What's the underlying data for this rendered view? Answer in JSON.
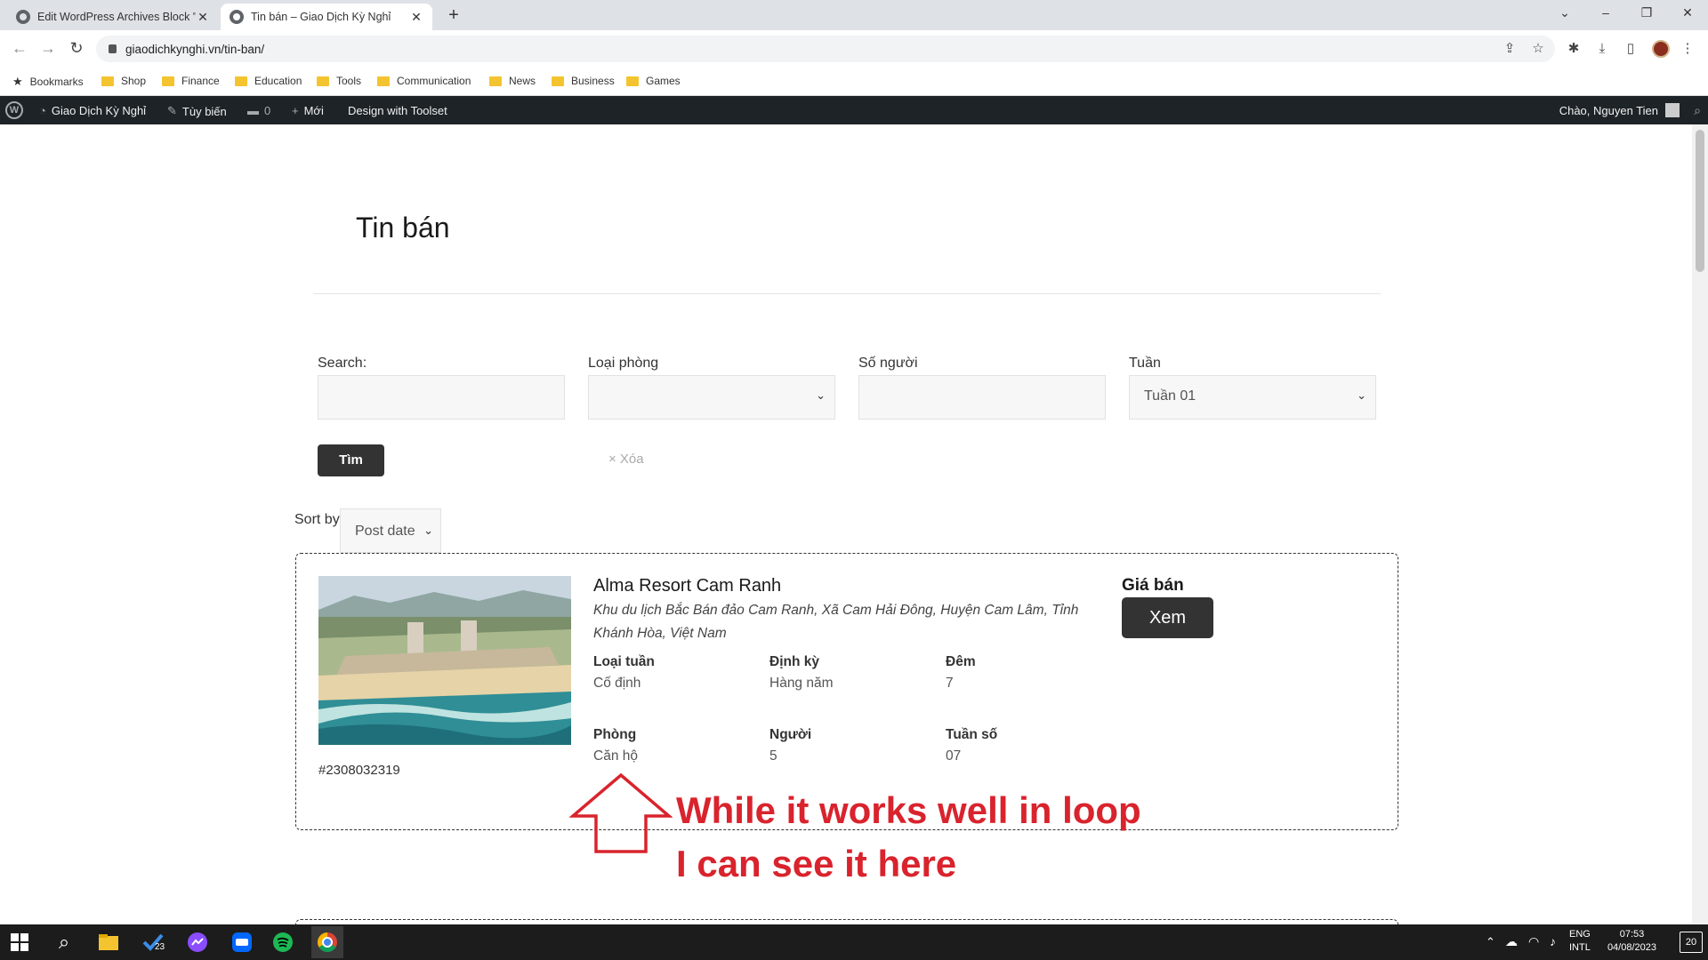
{
  "browser": {
    "tabs": [
      {
        "title": "Edit WordPress Archives Block \"T",
        "active": false
      },
      {
        "title": "Tin bán – Giao Dịch Kỳ Nghỉ",
        "active": true
      }
    ],
    "url": "giaodichkynghi.vn/tin-ban/",
    "bookmarks": [
      "Bookmarks",
      "Shop",
      "Finance",
      "Education",
      "Tools",
      "Communication",
      "News",
      "Business",
      "Games"
    ]
  },
  "admin_bar": {
    "site_name": "Giao Dịch Kỳ Nghỉ",
    "customize": "Tùy biến",
    "comments_count": "0",
    "new_label": "Mới",
    "toolset": "Design with Toolset",
    "greeting": "Chào, Nguyen Tien"
  },
  "page": {
    "title": "Tin bán"
  },
  "filters": {
    "search_label": "Search:",
    "search_value": "",
    "room_type_label": "Loại phòng",
    "room_type_value": "",
    "persons_label": "Số người",
    "persons_value": "",
    "week_label": "Tuần",
    "week_value": "Tuần 01",
    "submit_label": "Tìm",
    "reset_label": "× Xóa",
    "sort_label": "Sort by",
    "sort_value": "Post date"
  },
  "listing": {
    "name": "Alma Resort Cam Ranh",
    "address": "Khu du lịch Bắc Bán đảo Cam Ranh, Xã Cam Hải Đông, Huyện Cam Lâm, Tỉnh Khánh Hòa, Việt Nam",
    "ref": "#2308032319",
    "fields": [
      {
        "label": "Loại tuần",
        "value": "Cố định"
      },
      {
        "label": "Định kỳ",
        "value": "Hàng năm"
      },
      {
        "label": "Đêm",
        "value": "7"
      },
      {
        "label": "Phòng",
        "value": "Căn hộ"
      },
      {
        "label": "Người",
        "value": "5"
      },
      {
        "label": "Tuần số",
        "value": "07"
      }
    ],
    "price_label": "Giá bán",
    "view_button": "Xem"
  },
  "annotation": {
    "line1": "While it works well in loop",
    "line2": "I can see it here",
    "color": "#d9232d"
  },
  "taskbar": {
    "chat_badge": "23",
    "lang_line1": "ENG",
    "lang_line2": "INTL",
    "time": "07:53",
    "date": "04/08/2023",
    "notifications": "20"
  }
}
